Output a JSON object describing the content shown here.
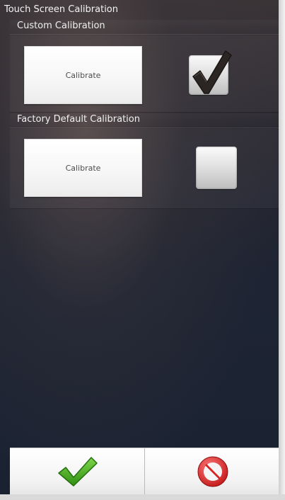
{
  "window": {
    "title": "Touch Screen Calibration"
  },
  "custom_section": {
    "header": "Custom Calibration",
    "button_label": "Calibrate",
    "checked": true
  },
  "factory_section": {
    "header": "Factory Default Calibration",
    "button_label": "Calibrate",
    "checked": false
  },
  "footer": {
    "ok_icon": "green-checkmark-icon",
    "cancel_icon": "red-prohibited-icon"
  },
  "colors": {
    "ok_green": "#3aa51e",
    "cancel_red": "#d92b2b"
  }
}
